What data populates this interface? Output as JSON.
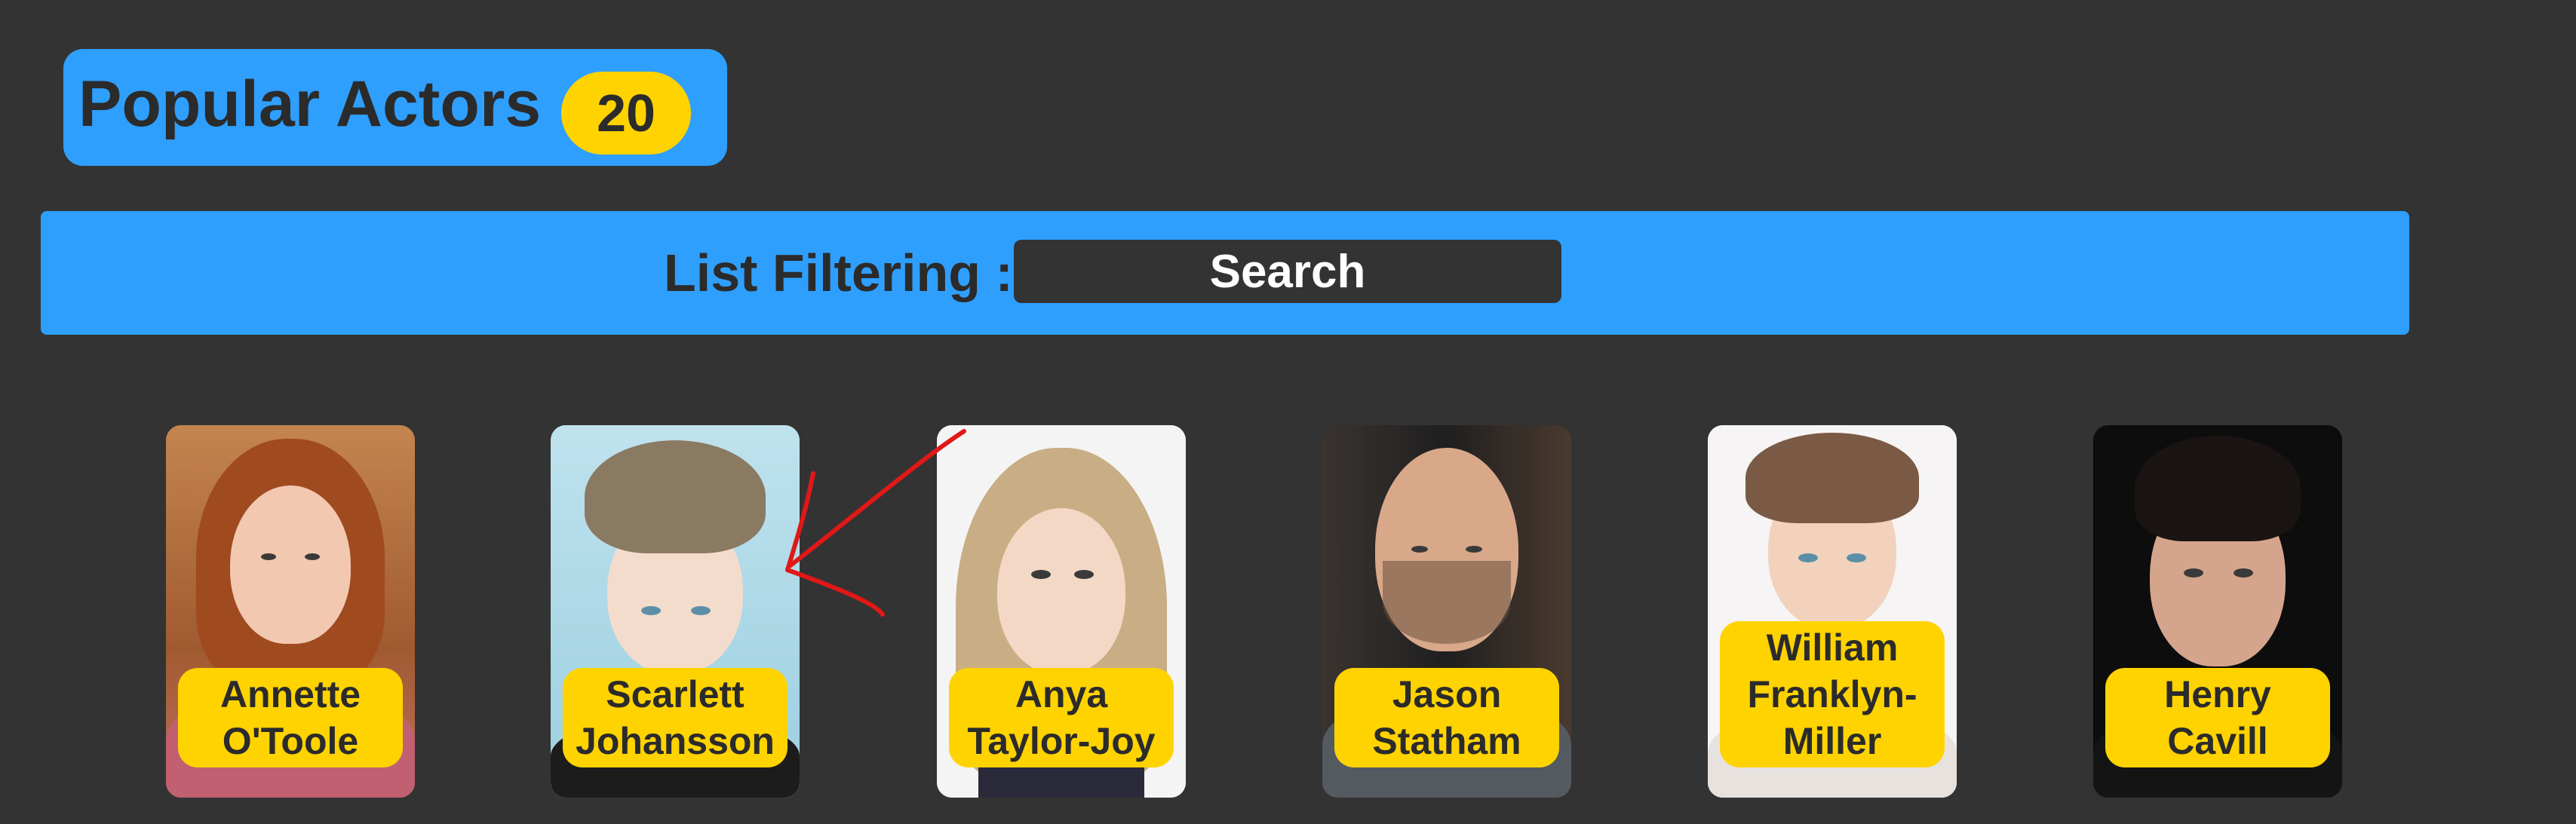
{
  "header": {
    "title": "Popular Actors",
    "count": "20"
  },
  "filter": {
    "label": "List Filtering :",
    "placeholder": "Search"
  },
  "actors": [
    {
      "name": "Annette O'Toole"
    },
    {
      "name": "Scarlett Johansson"
    },
    {
      "name": "Anya Taylor-Joy"
    },
    {
      "name": "Jason Statham"
    },
    {
      "name": "William Franklyn-Miller"
    },
    {
      "name": "Henry Cavill"
    }
  ],
  "colors": {
    "background": "#333333",
    "accent_blue": "#2f9ffe",
    "badge_yellow": "#ffd300",
    "annotation_red": "#e01818"
  }
}
